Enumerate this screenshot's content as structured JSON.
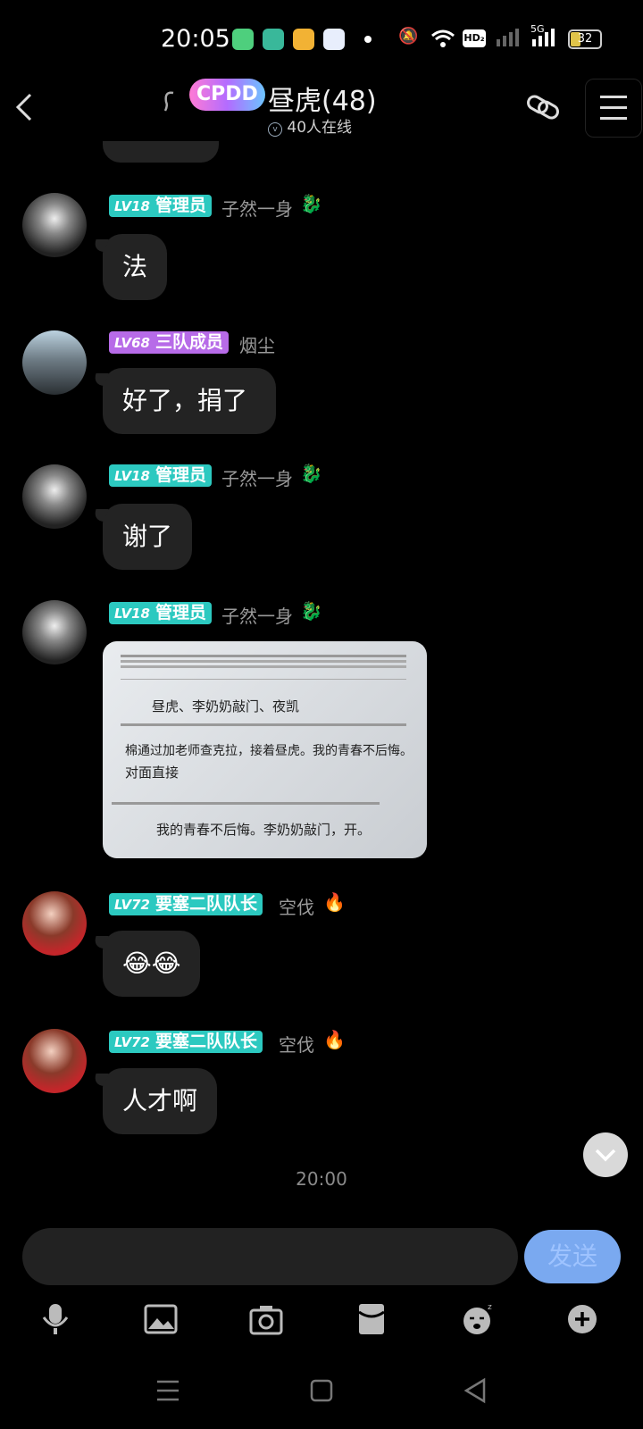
{
  "status_bar": {
    "time": "20:05",
    "network_type": "5G",
    "hd_label": "HD₂",
    "battery": "32"
  },
  "header": {
    "title": "昼虎(48)",
    "online": "40人在线",
    "logo_text": "CPDD"
  },
  "messages": [
    {
      "level": "LV18",
      "title": "管理员",
      "badge_color": "#2cc9c0",
      "name": "子然一身",
      "text": "法"
    },
    {
      "level": "LV68",
      "title": "三队成员",
      "badge_color": "#b76be8",
      "name": "烟尘",
      "text": "好了，捐了"
    },
    {
      "level": "LV18",
      "title": "管理员",
      "badge_color": "#2cc9c0",
      "name": "子然一身",
      "text": "谢了"
    },
    {
      "level": "LV18",
      "title": "管理员",
      "badge_color": "#2cc9c0",
      "name": "子然一身",
      "image": {
        "lines": [
          "昼虎、李奶奶敲门、夜凯",
          "棉通过加老师查克拉，接着昼虎。我的青春不后悔。",
          "对面直接",
          "我的青春不后悔。李奶奶敲门，开。"
        ]
      }
    },
    {
      "level": "LV72",
      "title": "要塞二队队长",
      "badge_color": "#2cc9c0",
      "name": "空伐",
      "text": "😂😂"
    },
    {
      "level": "LV72",
      "title": "要塞二队队长",
      "badge_color": "#2cc9c0",
      "name": "空伐",
      "text": "人才啊"
    }
  ],
  "timestamp": "20:00",
  "composer": {
    "input_placeholder": "",
    "send_label": "发送"
  },
  "toolbar": {
    "icons": [
      "microphone-icon",
      "image-icon",
      "camera-icon",
      "red-packet-icon",
      "emoji-icon",
      "plus-icon"
    ]
  },
  "colors": {
    "bubble": "#232323",
    "send_button": "#7aa9f0",
    "admin_badge": "#2cc9c0",
    "member_badge": "#b76be8"
  }
}
